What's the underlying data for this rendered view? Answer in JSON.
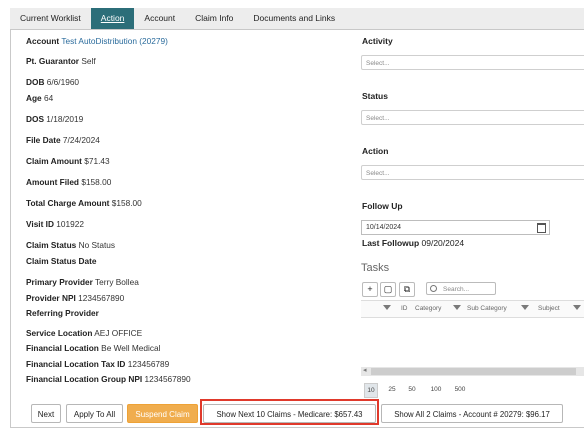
{
  "tabs": [
    "Current Worklist",
    "Action",
    "Account",
    "Claim Info",
    "Documents and Links"
  ],
  "fields": {
    "account_label": "Account",
    "account_value": "Test AutoDistribution (20279)",
    "guarantor_label": "Pt. Guarantor",
    "guarantor_value": "Self",
    "dob_label": "DOB",
    "dob_value": "6/6/1960",
    "age_label": "Age",
    "age_value": "64",
    "dos_label": "DOS",
    "dos_value": "1/18/2019",
    "file_date_label": "File Date",
    "file_date_value": "7/24/2024",
    "claim_amount_label": "Claim Amount",
    "claim_amount_value": "$71.43",
    "amount_filed_label": "Amount Filed",
    "amount_filed_value": "$158.00",
    "total_charge_label": "Total Charge Amount",
    "total_charge_value": "$158.00",
    "visit_id_label": "Visit ID",
    "visit_id_value": "101922",
    "claim_status_label": "Claim Status",
    "claim_status_value": "No Status",
    "claim_status_date_label": "Claim Status Date",
    "primary_provider_label": "Primary Provider",
    "primary_provider_value": "Terry Bollea",
    "provider_npi_label": "Provider NPI",
    "provider_npi_value": "1234567890",
    "referring_provider_label": "Referring Provider",
    "service_location_label": "Service Location",
    "service_location_value": "AEJ OFFICE",
    "financial_location_label": "Financial Location",
    "financial_location_value": "Be Well Medical",
    "fin_tax_label": "Financial Location Tax ID",
    "fin_tax_value": "123456789",
    "fin_group_npi_label": "Financial Location Group NPI",
    "fin_group_npi_value": "1234567890"
  },
  "right": {
    "activity_label": "Activity",
    "status_label": "Status",
    "action_label": "Action",
    "select_placeholder": "Select...",
    "follow_up_label": "Follow Up",
    "follow_up_value": "10/14/2024",
    "last_followup_label": "Last Followup",
    "last_followup_value": "09/20/2024",
    "tasks_title": "Tasks",
    "search_placeholder": "Search...",
    "columns": [
      "ID",
      "Category",
      "Sub Category",
      "Subject"
    ],
    "page_sizes": [
      "10",
      "25",
      "50",
      "100",
      "500"
    ]
  },
  "buttons": {
    "next": "Next",
    "apply_to_all": "Apply To All",
    "suspend": "Suspend Claim",
    "show_next": "Show Next 10 Claims - Medicare: $657.43",
    "show_all": "Show All 2 Claims - Account # 20279: $96.17"
  },
  "colors": {
    "active_tab": "#2c6e79",
    "suspend": "#f0ad4e",
    "highlight": "#e0392b",
    "link": "#2a6b9c"
  }
}
